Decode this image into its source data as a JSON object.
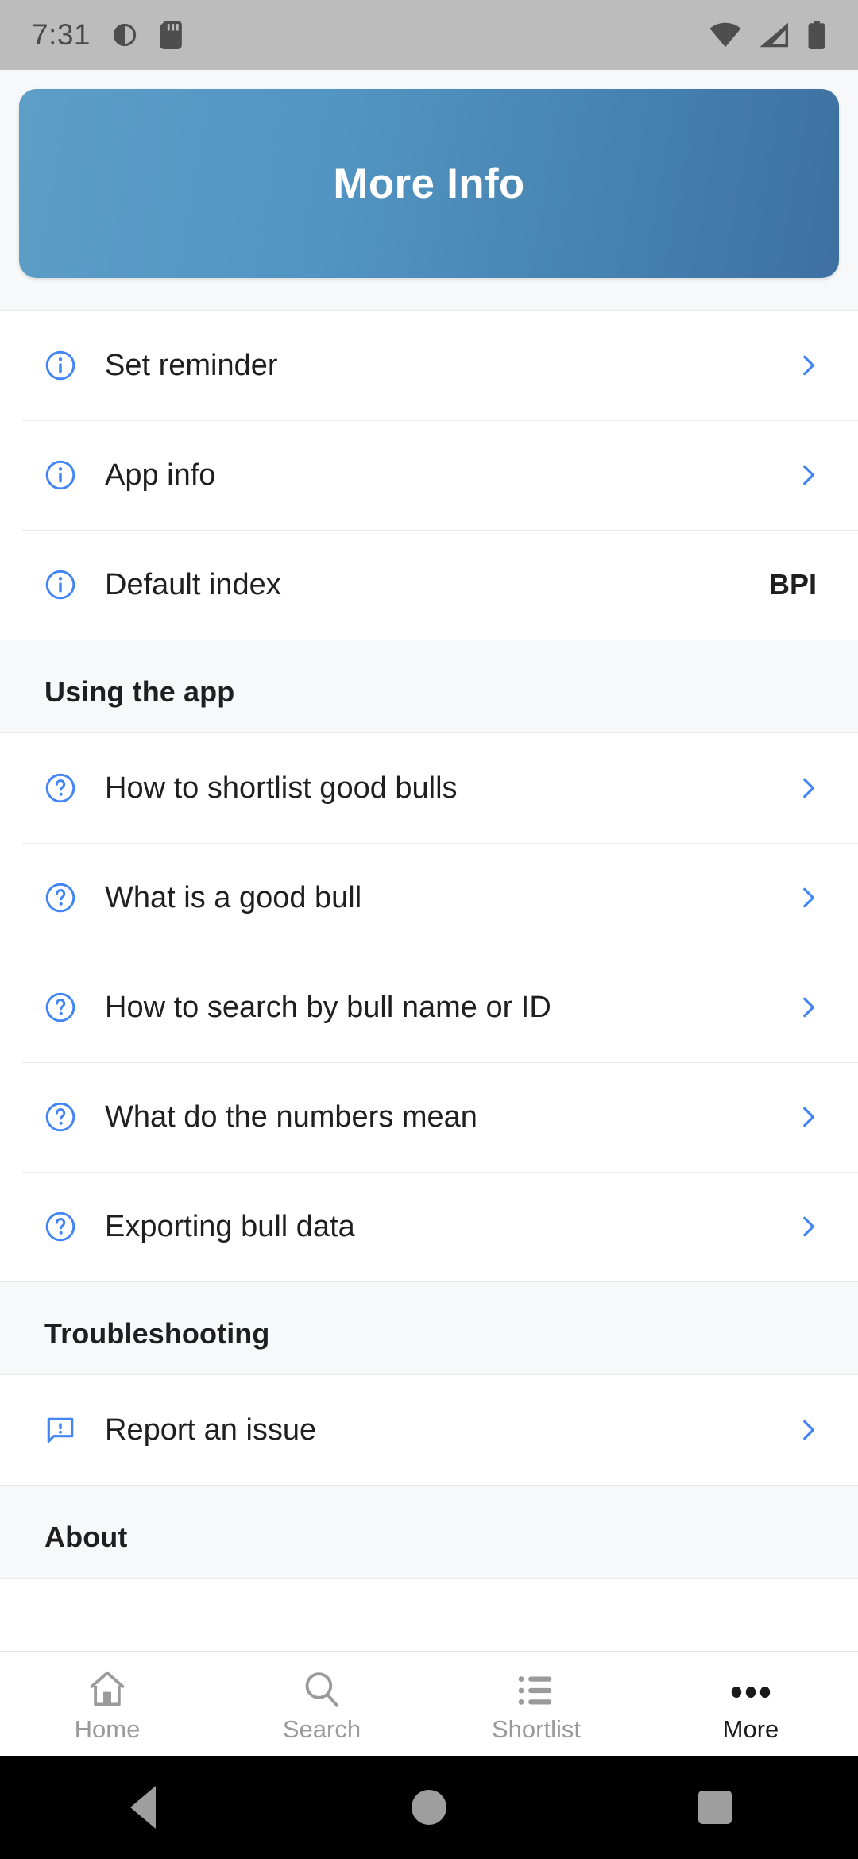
{
  "status_bar": {
    "time": "7:31",
    "left_icons": [
      "do-not-disturb-icon",
      "sd-card-icon"
    ],
    "right_icons": [
      "wifi-icon",
      "cellular-signal-icon",
      "battery-icon"
    ]
  },
  "header": {
    "title": "More Info",
    "gradient_start": "#5c9ec7",
    "gradient_end": "#3d70a1"
  },
  "accent_color": "#4285f4",
  "sections": [
    {
      "title": "",
      "rows": [
        {
          "icon": "info-circle-icon",
          "label": "Set reminder",
          "value": "",
          "chevron": true
        },
        {
          "icon": "info-circle-icon",
          "label": "App info",
          "value": "",
          "chevron": true
        },
        {
          "icon": "info-circle-icon",
          "label": "Default index",
          "value": "BPI",
          "chevron": false
        }
      ]
    },
    {
      "title": "Using the app",
      "rows": [
        {
          "icon": "help-circle-icon",
          "label": "How to shortlist good bulls",
          "value": "",
          "chevron": true
        },
        {
          "icon": "help-circle-icon",
          "label": "What is a good bull",
          "value": "",
          "chevron": true
        },
        {
          "icon": "help-circle-icon",
          "label": "How to search by bull name or ID",
          "value": "",
          "chevron": true
        },
        {
          "icon": "help-circle-icon",
          "label": "What do the numbers mean",
          "value": "",
          "chevron": true
        },
        {
          "icon": "help-circle-icon",
          "label": "Exporting bull data",
          "value": "",
          "chevron": true
        }
      ]
    },
    {
      "title": "Troubleshooting",
      "rows": [
        {
          "icon": "feedback-icon",
          "label": "Report an issue",
          "value": "",
          "chevron": true
        }
      ]
    },
    {
      "title": "About",
      "rows": []
    }
  ],
  "bottom_nav": {
    "tabs": [
      {
        "icon": "home-icon",
        "label": "Home",
        "active": false
      },
      {
        "icon": "search-icon",
        "label": "Search",
        "active": false
      },
      {
        "icon": "list-icon",
        "label": "Shortlist",
        "active": false
      },
      {
        "icon": "more-dots-icon",
        "label": "More",
        "active": true
      }
    ]
  },
  "android_nav": {
    "buttons": [
      "back-icon",
      "home-icon",
      "recents-icon"
    ]
  }
}
